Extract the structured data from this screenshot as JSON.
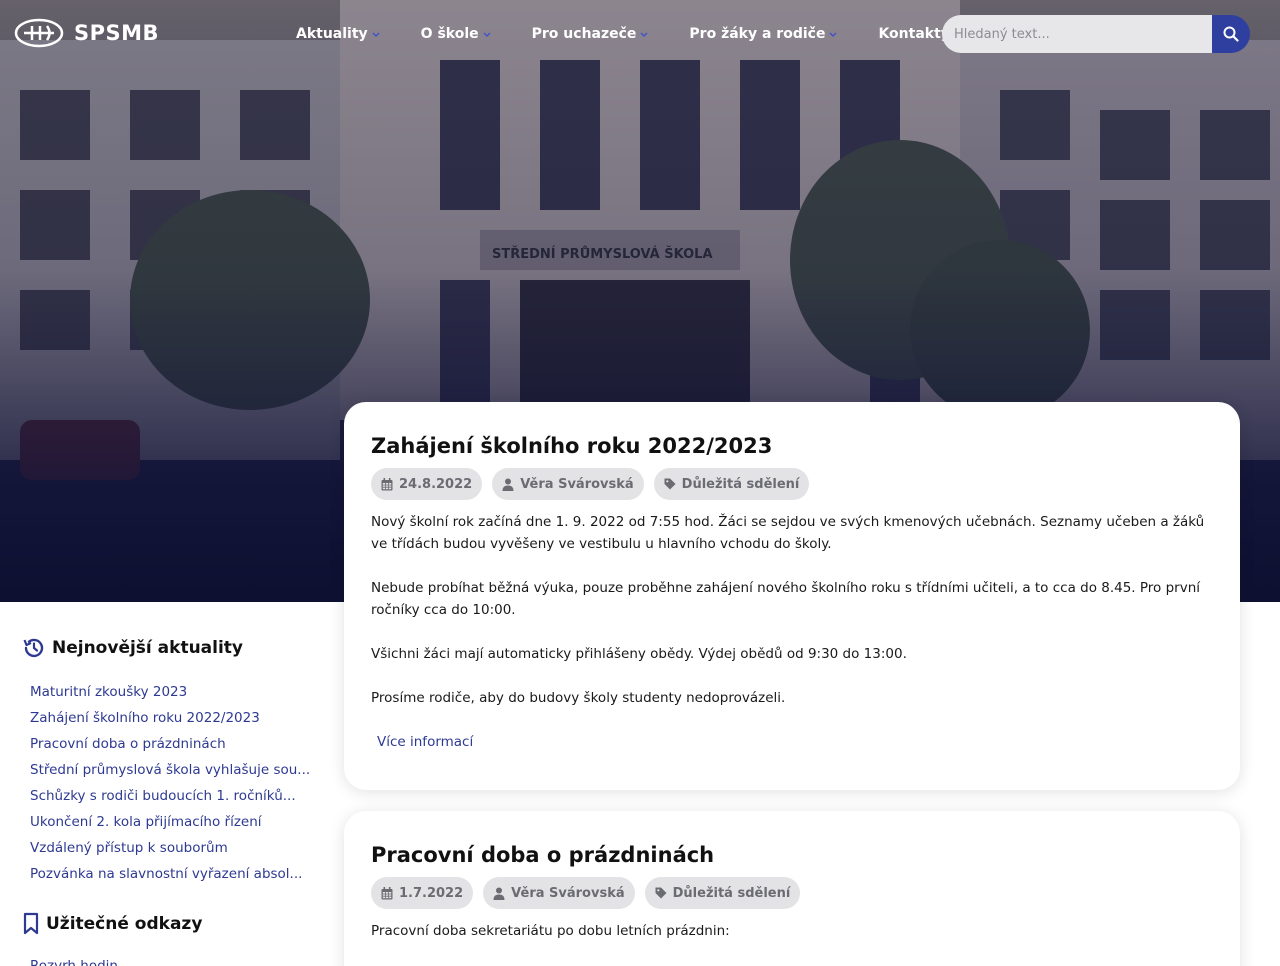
{
  "brand": {
    "name": "SPSMB"
  },
  "nav": {
    "items": [
      {
        "label": "Aktuality",
        "has_dropdown": true
      },
      {
        "label": "O škole",
        "has_dropdown": true
      },
      {
        "label": "Pro uchazeče",
        "has_dropdown": true
      },
      {
        "label": "Pro žáky a rodiče",
        "has_dropdown": true
      },
      {
        "label": "Kontakty",
        "has_dropdown": false
      }
    ],
    "search": {
      "placeholder": "Hledaný text...",
      "value": ""
    }
  },
  "sidebar": {
    "recent_heading": "Nejnovější aktuality",
    "recent": [
      "Maturitní zkoušky 2023",
      "Zahájení školního roku 2022/2023",
      "Pracovní doba o prázdninách",
      "Střední průmyslová škola vyhlašuje sou...",
      "Schůzky s rodiči budoucích 1. ročníků...",
      "Ukončení 2. kola přijímacího řízení",
      "Vzdálený přístup k souborům",
      "Pozvánka na slavnostní vyřazení absol..."
    ],
    "links_heading": "Užitečné odkazy",
    "links": [
      "Rozvrh hodin"
    ]
  },
  "posts": [
    {
      "title": "Zahájení školního roku 2022/2023",
      "date": "24.8.2022",
      "author": "Věra Svárovská",
      "category": "Důležitá sdělení",
      "paragraphs": [
        "Nový školní rok začíná dne 1. 9. 2022 od 7:55 hod. Žáci se sejdou ve svých kmenových učebnách. Seznamy učeben a žáků ve třídách budou vyvěšeny ve vestibulu u hlavního vchodu do školy.",
        "Nebude probíhat běžná výuka, pouze proběhne zahájení nového školního roku s třídními učiteli, a to cca do 8.45. Pro první ročníky cca do 10:00.",
        "Všichni žáci mají automaticky přihlášeny obědy. Výdej obědů od 9:30 do 13:00.",
        "Prosíme rodiče, aby do budovy školy studenty nedoprovázeli."
      ],
      "more_label": "Více informací"
    },
    {
      "title": "Pracovní doba o prázdninách",
      "date": "1.7.2022",
      "author": "Věra Svárovská",
      "category": "Důležitá sdělení",
      "paragraphs": [
        "Pracovní doba sekretariátu po dobu letních prázdnin:"
      ]
    }
  ],
  "colors": {
    "accent": "#2f3fa0",
    "link": "#2e3a92",
    "pill_bg": "#e3e3e6"
  },
  "icons": {
    "search": "search-icon",
    "history": "history-icon",
    "bookmark": "bookmark-icon",
    "calendar": "calendar-icon",
    "user": "user-icon",
    "tag": "tag-icon",
    "caret": "chevron-down-icon"
  }
}
